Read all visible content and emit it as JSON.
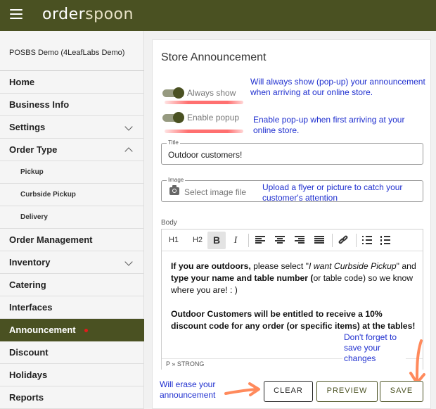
{
  "topbar": {
    "logo_prefix": "order",
    "logo_suffix": "spoon"
  },
  "sidebar": {
    "org_name": "POSBS Demo (4LeafLabs Demo)",
    "items": [
      {
        "label": "Home"
      },
      {
        "label": "Business Info"
      },
      {
        "label": "Settings"
      },
      {
        "label": "Order Type"
      },
      {
        "label": "Pickup"
      },
      {
        "label": "Curbside Pickup"
      },
      {
        "label": "Delivery"
      },
      {
        "label": "Order Management"
      },
      {
        "label": "Inventory"
      },
      {
        "label": "Catering"
      },
      {
        "label": "Interfaces"
      },
      {
        "label": "Announcement"
      },
      {
        "label": "Discount"
      },
      {
        "label": "Holidays"
      },
      {
        "label": "Reports"
      }
    ]
  },
  "panel": {
    "title": "Store Announcement",
    "always_show_label": "Always show",
    "enable_popup_label": "Enable popup",
    "title_field": {
      "legend": "Title",
      "value": "Outdoor customers!"
    },
    "image_field": {
      "legend": "Image",
      "placeholder": "Select image file"
    },
    "body_label": "Body",
    "toolbar": {
      "h1": "H1",
      "h2": "H2",
      "bold": "B",
      "italic": "I"
    },
    "content": {
      "p1_bold_1": "If you are outdoors,",
      "p1_text_1": " please select \"",
      "p1_italic": "I want Curbside Pickup",
      "p1_text_2": "\" and ",
      "p1_bold_2": "type your name and table number (",
      "p1_text_3": "or table code)  so we know where you are! : )",
      "p2_bold": "Outdoor Customers will be entitled to receive a  10% discount code for any order (or specific items) at the tables!"
    },
    "status_path": "P » STRONG",
    "buttons": {
      "clear": "CLEAR",
      "preview": "PREVIEW",
      "save": "SAVE"
    }
  },
  "annotations": {
    "always_show": "Will always show  (pop-up) your announcement when arriving  at our online store.",
    "enable_popup": "Enable pop-up when first arriving at your online store.",
    "image": "Upload a flyer or picture to catch your customer's attention",
    "save": "Don't forget to save your changes",
    "clear": "Will erase your announcement"
  },
  "colors": {
    "brand": "#4a5122",
    "annotation": "#1f2fcf",
    "highlight": "#ff7070"
  }
}
